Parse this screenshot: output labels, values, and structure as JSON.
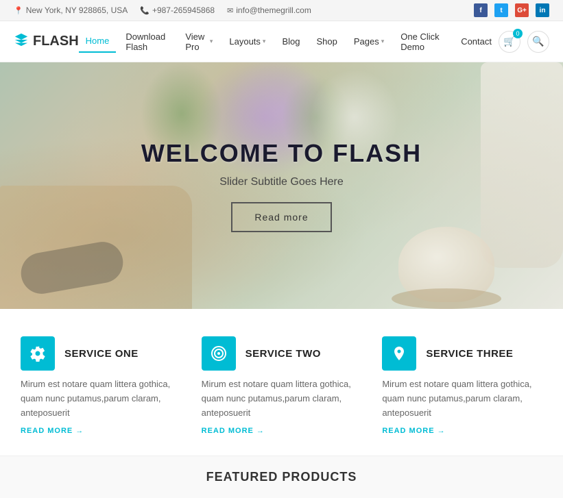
{
  "topbar": {
    "address": "New York, NY 928865, USA",
    "phone": "+987-265945868",
    "email": "info@themegrill.com",
    "socials": [
      "f",
      "t",
      "G+",
      "in"
    ]
  },
  "header": {
    "logo_text": "FLASH",
    "nav": [
      {
        "label": "Home",
        "active": true,
        "hasDropdown": false
      },
      {
        "label": "Download Flash",
        "active": false,
        "hasDropdown": false
      },
      {
        "label": "View Pro",
        "active": false,
        "hasDropdown": true
      },
      {
        "label": "Layouts",
        "active": false,
        "hasDropdown": true
      },
      {
        "label": "Blog",
        "active": false,
        "hasDropdown": false
      },
      {
        "label": "Shop",
        "active": false,
        "hasDropdown": false
      },
      {
        "label": "Pages",
        "active": false,
        "hasDropdown": true
      },
      {
        "label": "One Click Demo",
        "active": false,
        "hasDropdown": false
      },
      {
        "label": "Contact",
        "active": false,
        "hasDropdown": false
      }
    ],
    "cart_count": "0"
  },
  "hero": {
    "title": "WELCOME TO FLASH",
    "subtitle": "Slider Subtitle Goes Here",
    "btn_label": "Read more"
  },
  "services": [
    {
      "icon": "gear",
      "title": "SERVICE ONE",
      "text": "Mirum est notare quam littera gothica, quam nunc putamus,parum claram, anteposuerit",
      "link": "READ MORE"
    },
    {
      "icon": "target",
      "title": "SERVICE TWO",
      "text": "Mirum est notare quam littera gothica, quam nunc putamus,parum claram, anteposuerit",
      "link": "READ MORE"
    },
    {
      "icon": "pin",
      "title": "SERVICE THREE",
      "text": "Mirum est notare quam littera gothica, quam nunc putamus,parum claram, anteposuerit",
      "link": "READ MORE"
    }
  ],
  "featured": {
    "title": "FEATURED PRODUCTS"
  }
}
